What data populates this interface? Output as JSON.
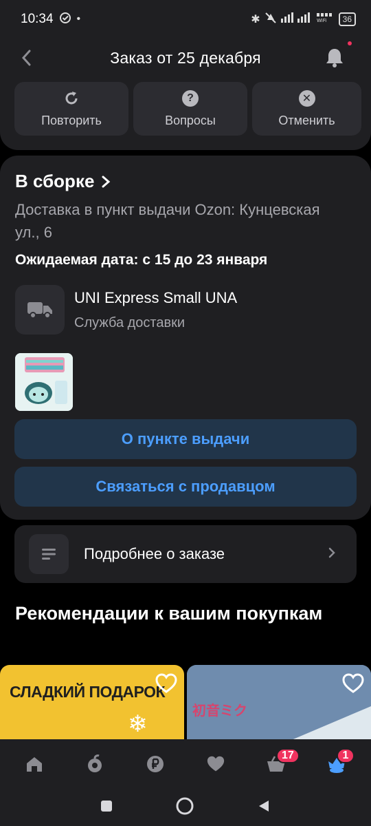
{
  "status_bar": {
    "time": "10:34",
    "battery": "36",
    "icons": [
      "check-circle-icon",
      "bluetooth-icon",
      "mute-icon",
      "signal-icon",
      "wifi-icon",
      "battery-icon"
    ]
  },
  "header": {
    "title": "Заказ от 25 декабря",
    "back_icon": "chevron-left-icon",
    "bell_icon": "bell-icon"
  },
  "actions": [
    {
      "label": "Повторить",
      "icon": "repeat-icon"
    },
    {
      "label": "Вопросы",
      "icon": "question-icon"
    },
    {
      "label": "Отменить",
      "icon": "cancel-icon"
    }
  ],
  "order": {
    "status": "В сборке",
    "delivery": "Доставка в пункт выдачи Ozon: Кунцевская ул., 6",
    "expected_date": "Ожидаемая дата: с 15 до 23 января",
    "service_name": "UNI Express Small UNA",
    "service_sub": "Служба доставки",
    "pickup_button": "О пункте выдачи",
    "seller_button": "Связаться с продавцом"
  },
  "details": {
    "label": "Подробнее о заказе"
  },
  "recommendations": {
    "title": "Рекомендации к вашим покупкам",
    "card1_text": "СЛАДКИЙ ПОДАРОК",
    "card2_text": "初音ミク"
  },
  "bottom_nav": {
    "items": [
      "home-icon",
      "fresh-icon",
      "ruble-icon",
      "favorites-icon",
      "cart-icon",
      "profile-icon"
    ],
    "cart_badge": "17",
    "profile_badge": "1"
  },
  "colors": {
    "background": "#000000",
    "card": "#1f1f22",
    "button": "#2c2c31",
    "accent": "#4c9eff",
    "badge": "#f0335f"
  }
}
